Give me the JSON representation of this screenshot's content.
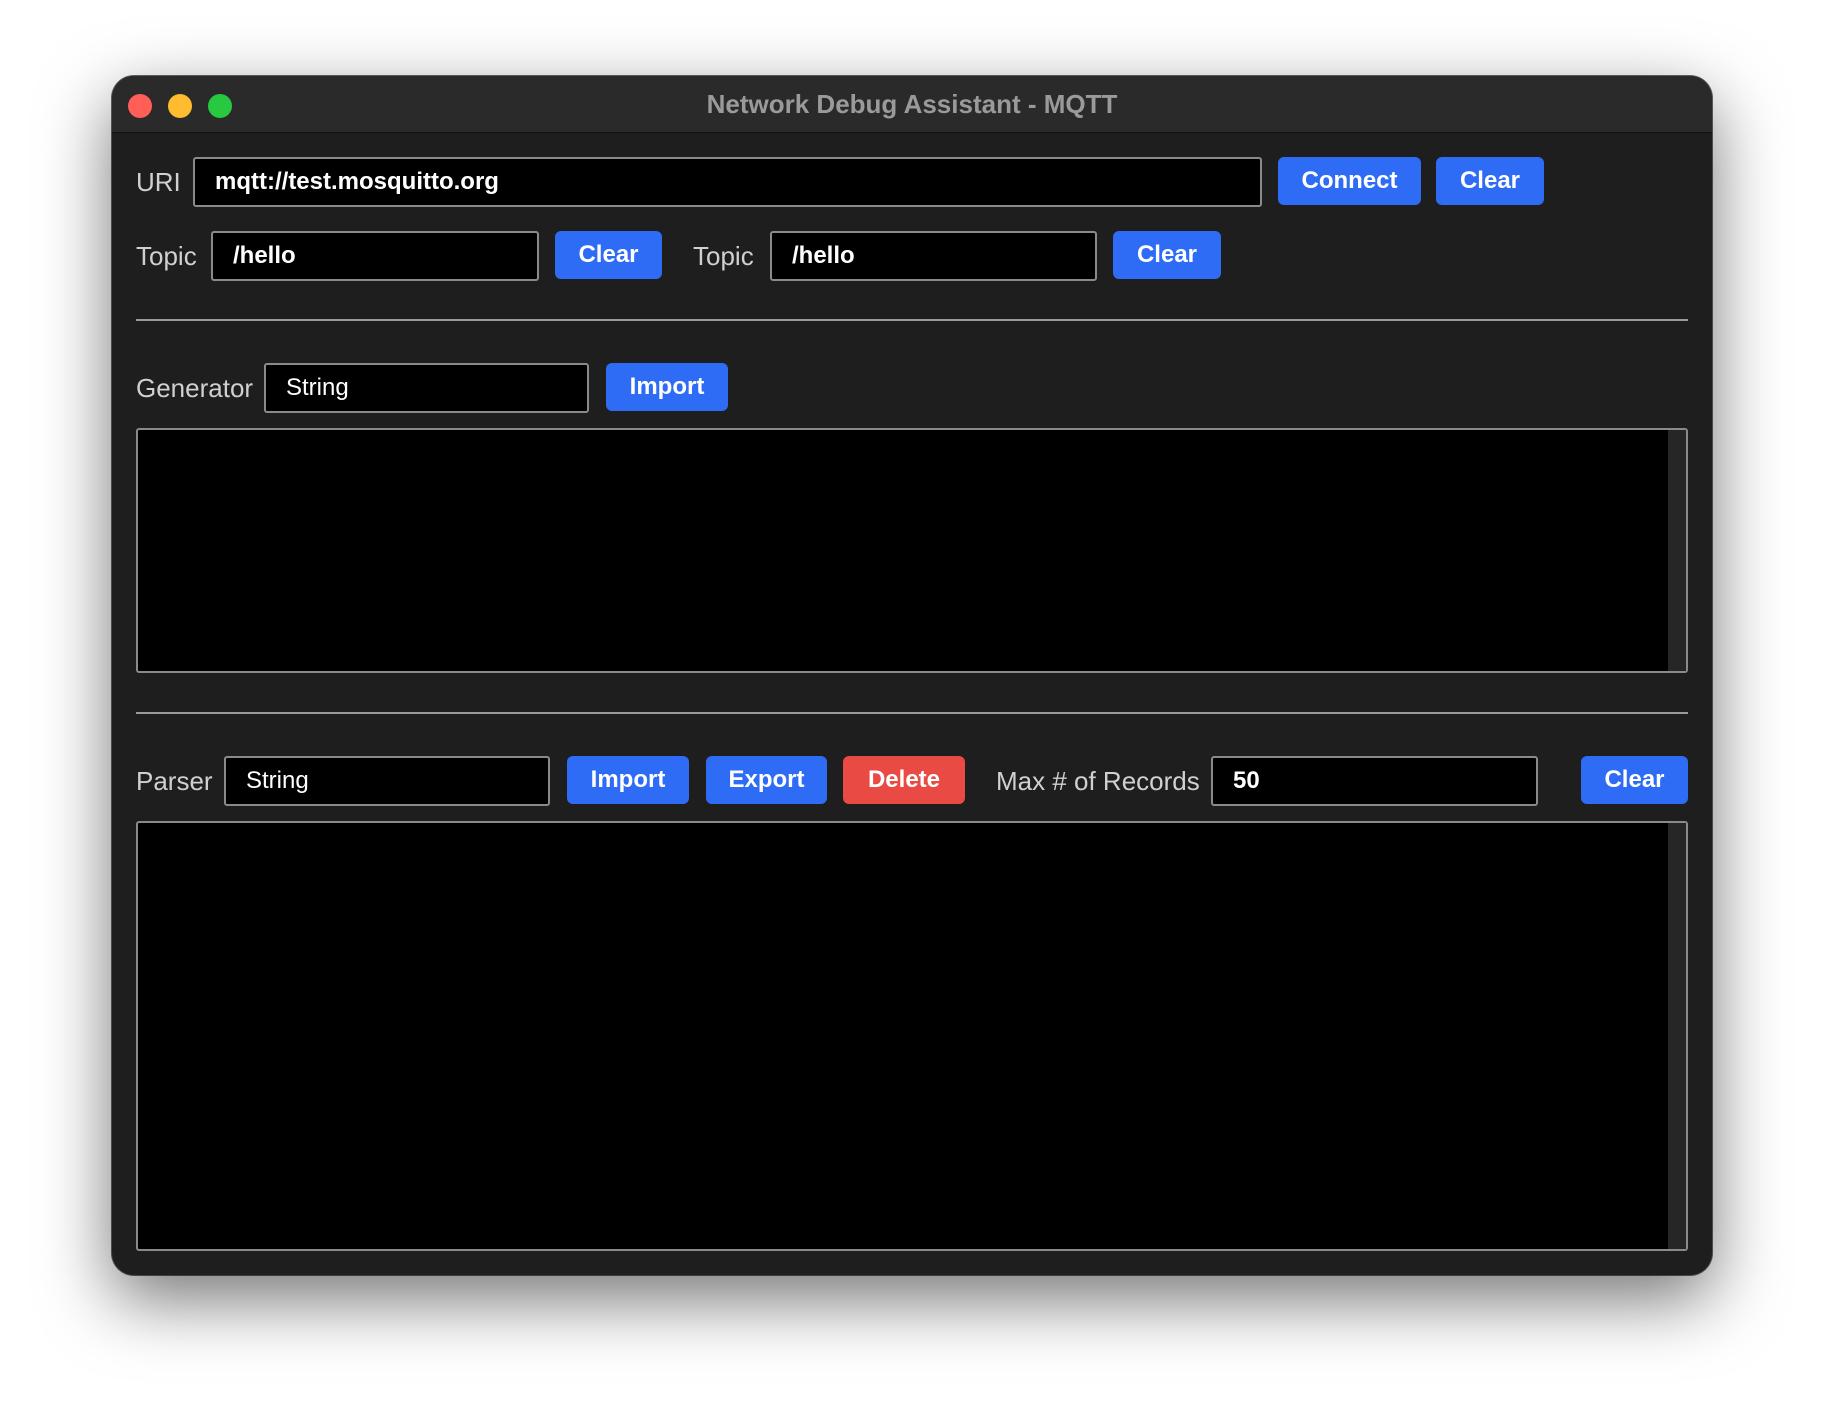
{
  "window": {
    "title": "Network Debug Assistant - MQTT"
  },
  "connection": {
    "uri_label": "URI",
    "uri_value": "mqtt://test.mosquitto.org",
    "connect_label": "Connect",
    "clear_label": "Clear"
  },
  "topics": {
    "publish": {
      "label": "Topic",
      "value": "/hello",
      "clear_label": "Clear"
    },
    "subscribe": {
      "label": "Topic",
      "value": "/hello",
      "clear_label": "Clear"
    }
  },
  "generator": {
    "label": "Generator",
    "value": "String",
    "import_label": "Import",
    "content": ""
  },
  "parser": {
    "label": "Parser",
    "value": "String",
    "import_label": "Import",
    "export_label": "Export",
    "delete_label": "Delete",
    "max_records_label": "Max # of Records",
    "max_records_value": "50",
    "clear_label": "Clear",
    "content": ""
  },
  "colors": {
    "accent": "#2f6cf5",
    "danger": "#ea4a44",
    "window_bg": "#1e1e1e",
    "field_bg": "#000000"
  }
}
